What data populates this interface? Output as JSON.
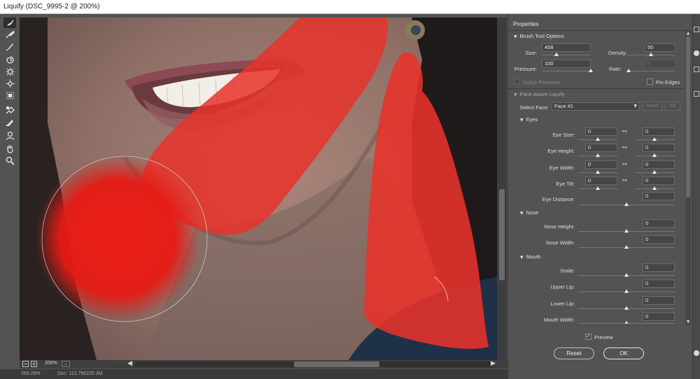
{
  "window": {
    "title": "Liquify (DSC_9995-2 @ 200%)"
  },
  "toolbar": {
    "tools": [
      {
        "name": "forward-warp-tool-icon",
        "active": true
      },
      {
        "name": "reconstruct-tool-icon"
      },
      {
        "name": "smooth-tool-icon"
      },
      {
        "name": "twirl-clockwise-tool-icon"
      },
      {
        "name": "pucker-tool-icon"
      },
      {
        "name": "bloat-tool-icon"
      },
      {
        "name": "push-left-tool-icon"
      },
      {
        "name": "freeze-mask-tool-icon"
      },
      {
        "name": "thaw-mask-tool-icon"
      },
      {
        "name": "face-tool-icon"
      },
      {
        "name": "hand-tool-icon"
      },
      {
        "name": "zoom-tool-icon"
      }
    ]
  },
  "canvas": {
    "mask_color": "#e8322a"
  },
  "bottom": {
    "zoom_out": "−",
    "zoom_in": "+",
    "zoom_value": "200%",
    "zoom_dropdown": "⌄",
    "scroll_left": "◀",
    "scroll_right": "▶"
  },
  "status": {
    "left": "269.26%",
    "doc": "Doc: 112.7M/225.3M"
  },
  "panel": {
    "title": "Properties",
    "brush": {
      "header": "Brush Tool Options",
      "size_label": "Size:",
      "size_value": "458",
      "size_level": 0.3,
      "density_label": "Density:",
      "density_value": "50",
      "density_level": 0.5,
      "pressure_label": "Pressure:",
      "pressure_value": "100",
      "pressure_level": 1.0,
      "rate_label": "Rate:",
      "rate_value": "0",
      "rate_level": 0.0,
      "stylus_label": "Stylus Pressure",
      "pin_edges_label": "Pin Edges"
    },
    "face": {
      "header": "Face-Aware Liquify",
      "select_face_label": "Select Face:",
      "select_face_value": "Face #1",
      "reset_label": "Reset",
      "all_label": "All",
      "eyes": {
        "header": "Eyes",
        "rows": [
          {
            "label": "Eye Size:",
            "left": "0",
            "right": "0"
          },
          {
            "label": "Eye Height:",
            "left": "0",
            "right": "0"
          },
          {
            "label": "Eye Width:",
            "left": "0",
            "right": "0"
          },
          {
            "label": "Eye Tilt:",
            "left": "0",
            "right": "0"
          }
        ],
        "distance_label": "Eye Distance:",
        "distance_value": "0"
      },
      "nose": {
        "header": "Nose",
        "height_label": "Nose Height:",
        "height_value": "0",
        "width_label": "Nose Width:",
        "width_value": "0"
      },
      "mouth": {
        "header": "Mouth",
        "smile_label": "Smile:",
        "smile_value": "0",
        "upper_label": "Upper Lip:",
        "upper_value": "0",
        "lower_label": "Lower Lip:",
        "lower_value": "0",
        "width_label": "Mouth Width:",
        "width_value": "0"
      }
    },
    "preview_label": "Preview",
    "reset_button": "Reset",
    "ok_button": "OK"
  }
}
